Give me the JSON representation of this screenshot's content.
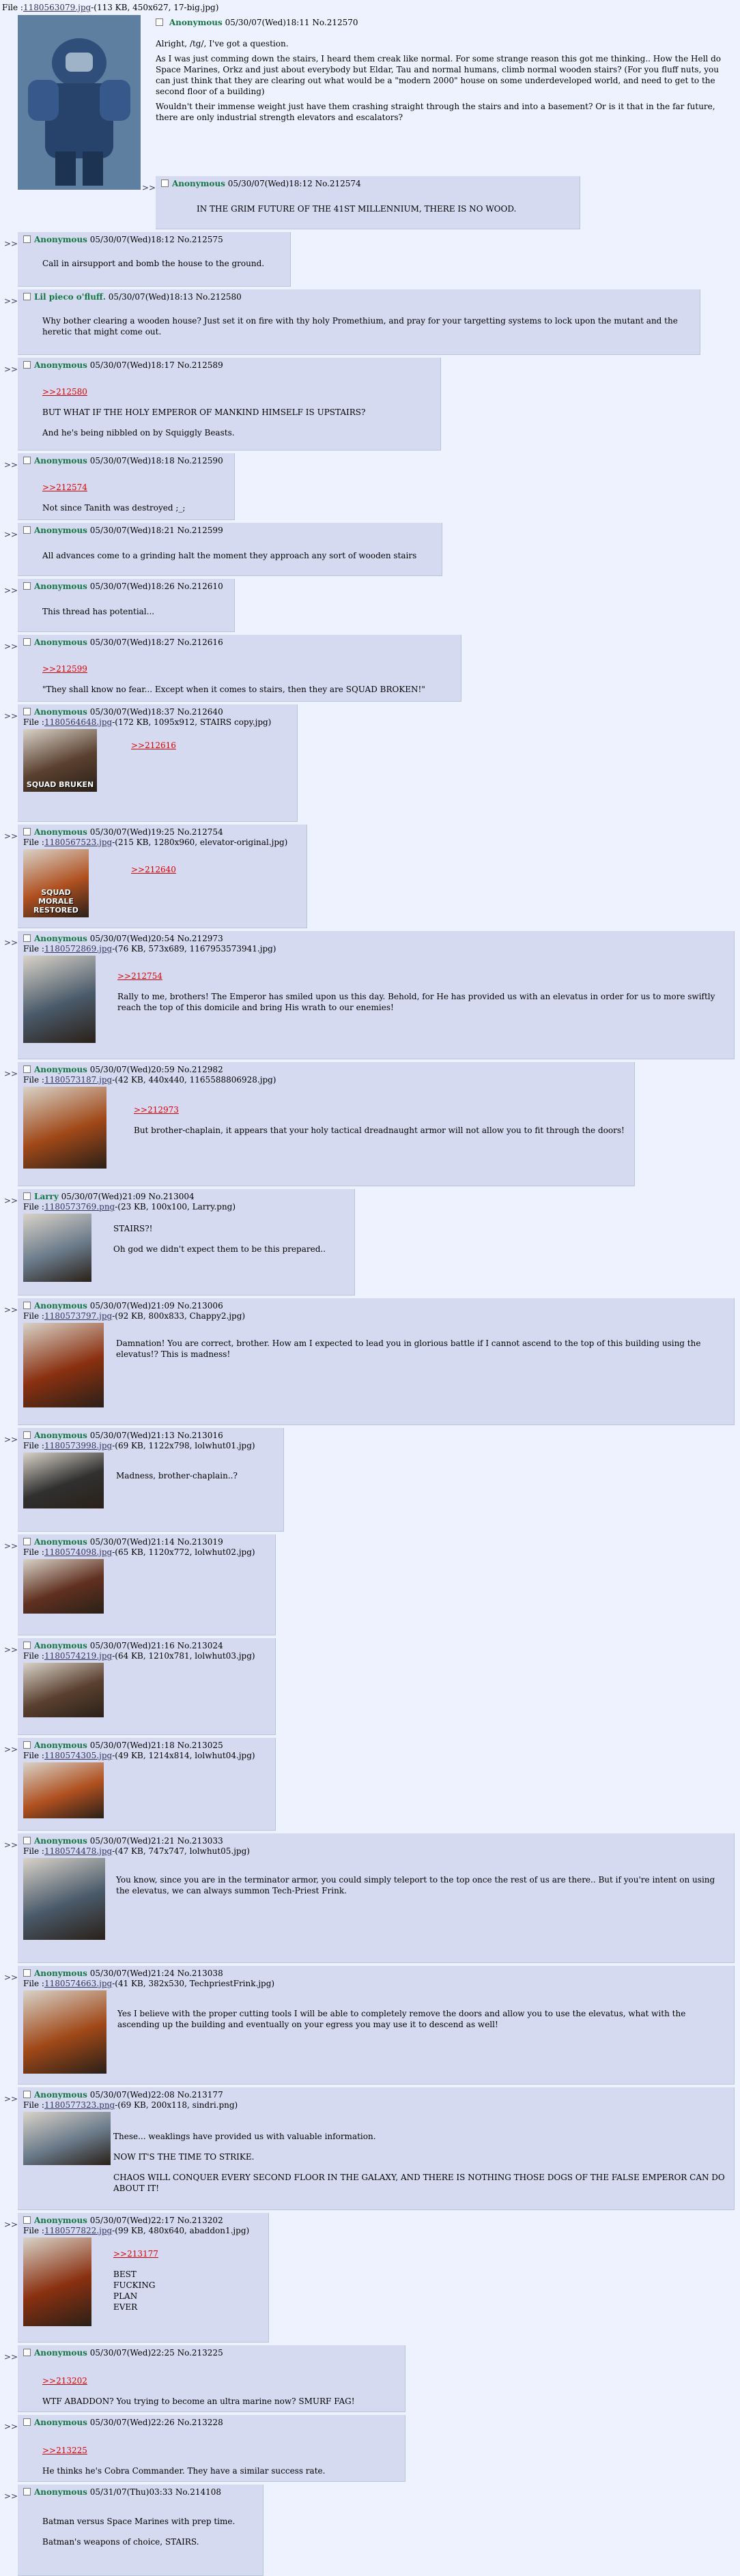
{
  "op": {
    "file_label": "File :",
    "file_name": "1180563079.jpg",
    "file_meta": "-(113 KB, 450x627, 17-big.jpg)",
    "name": "Anonymous",
    "date": "05/30/07(Wed)18:11",
    "no": "No.212570",
    "paragraphs": [
      "Alright, /tg/, I've got a question.",
      "As I was just comming down the stairs, I heard them creak like normal. For some strange reason this got me thinking.. How the Hell do Space Marines, Orkz and just about everybody but Eldar, Tau and normal humans, climb normal wooden stairs? (For you fluff nuts, you can just think that they are clearing out what would be a \"modern 2000\" house on some underdeveloped world, and need to get to the second floor of a building)",
      "Wouldn't their immense weight just have them crashing straight through the stairs and into a basement? Or is it that in the far future, there are only industrial strength elevators and escalators?"
    ]
  },
  "posts": [
    {
      "name": "Anonymous",
      "date": "05/30/07(Wed)18:12",
      "no": "No.212574",
      "lines": [
        "IN THE GRIM FUTURE OF THE 41ST MILLENNIUM, THERE IS NO WOOD."
      ]
    },
    {
      "name": "Anonymous",
      "date": "05/30/07(Wed)18:12",
      "no": "No.212575",
      "lines": [
        "Call in airsupport and bomb the house to the ground."
      ]
    },
    {
      "name": "Lil pieco o'fluff.",
      "date": "05/30/07(Wed)18:13",
      "no": "No.212580",
      "lines": [
        "Why bother clearing a wooden house? Just set it on fire with thy holy Promethium, and pray for your targetting systems to lock upon the mutant and the heretic that might come out."
      ]
    },
    {
      "name": "Anonymous",
      "date": "05/30/07(Wed)18:17",
      "no": "No.212589",
      "ref": ">>212580",
      "lines": [
        "BUT WHAT IF THE HOLY EMPEROR OF MANKIND HIMSELF IS UPSTAIRS?",
        "And he's being nibbled on by Squiggly Beasts."
      ]
    },
    {
      "name": "Anonymous",
      "date": "05/30/07(Wed)18:18",
      "no": "No.212590",
      "ref": ">>212574",
      "lines": [
        "Not since Tanith was destroyed ;_;"
      ]
    },
    {
      "name": "Anonymous",
      "date": "05/30/07(Wed)18:21",
      "no": "No.212599",
      "lines": [
        "All advances come to a grinding halt the moment they approach any sort of wooden stairs"
      ]
    },
    {
      "name": "Anonymous",
      "date": "05/30/07(Wed)18:26",
      "no": "No.212610",
      "lines": [
        "This thread has potential..."
      ]
    },
    {
      "name": "Anonymous",
      "date": "05/30/07(Wed)18:27",
      "no": "No.212616",
      "ref": ">>212599",
      "lines": [
        "\"They shall know no fear... Except when it comes to stairs, then they are SQUAD BROKEN!\""
      ]
    },
    {
      "name": "Anonymous",
      "date": "05/30/07(Wed)18:37",
      "no": "No.212640",
      "file": "1180564648.jpg",
      "meta": "-(172 KB, 1095x912, STAIRS copy.jpg)",
      "ref": ">>212616",
      "lines": [],
      "caption": "SQUAD BRUKEN"
    },
    {
      "name": "Anonymous",
      "date": "05/30/07(Wed)19:25",
      "no": "No.212754",
      "file": "1180567523.jpg",
      "meta": "-(215 KB, 1280x960, elevator-original.jpg)",
      "ref": ">>212640",
      "lines": [],
      "caption": "SQUAD MORALE RESTORED"
    },
    {
      "name": "Anonymous",
      "date": "05/30/07(Wed)20:54",
      "no": "No.212973",
      "file": "1180572869.jpg",
      "meta": "-(76 KB, 573x689, 1167953573941.jpg)",
      "ref": ">>212754",
      "lines": [
        "Rally to me, brothers! The Emperor has smiled upon us this day. Behold, for He has provided us with an elevatus in order for us to more swiftly reach the top of this domicile and bring His wrath to our enemies!"
      ]
    },
    {
      "name": "Anonymous",
      "date": "05/30/07(Wed)20:59",
      "no": "No.212982",
      "file": "1180573187.jpg",
      "meta": "-(42 KB, 440x440, 1165588806928.jpg)",
      "ref": ">>212973",
      "lines": [
        "But brother-chaplain, it appears that your holy tactical dreadnaught armor will not allow you to fit through the doors!"
      ]
    },
    {
      "name": "Larry",
      "date": "05/30/07(Wed)21:09",
      "no": "No.213004",
      "file": "1180573769.png",
      "meta": "-(23 KB, 100x100, Larry.png)",
      "lines": [
        "STAIRS?!",
        "Oh god we didn't expect them to be this prepared.."
      ]
    },
    {
      "name": "Anonymous",
      "date": "05/30/07(Wed)21:09",
      "no": "No.213006",
      "file": "1180573797.jpg",
      "meta": "-(92 KB, 800x833, Chappy2.jpg)",
      "lines": [
        "Damnation! You are correct, brother. How am I expected to lead you in glorious battle if I cannot ascend to the top of this building using the elevatus!? This is madness!"
      ]
    },
    {
      "name": "Anonymous",
      "date": "05/30/07(Wed)21:13",
      "no": "No.213016",
      "file": "1180573998.jpg",
      "meta": "-(69 KB, 1122x798, lolwhut01.jpg)",
      "lines": [
        "Madness, brother-chaplain..?"
      ]
    },
    {
      "name": "Anonymous",
      "date": "05/30/07(Wed)21:14",
      "no": "No.213019",
      "file": "1180574098.jpg",
      "meta": "-(65 KB, 1120x772, lolwhut02.jpg)",
      "lines": []
    },
    {
      "name": "Anonymous",
      "date": "05/30/07(Wed)21:16",
      "no": "No.213024",
      "file": "1180574219.jpg",
      "meta": "-(64 KB, 1210x781, lolwhut03.jpg)",
      "lines": []
    },
    {
      "name": "Anonymous",
      "date": "05/30/07(Wed)21:18",
      "no": "No.213025",
      "file": "1180574305.jpg",
      "meta": "-(49 KB, 1214x814, lolwhut04.jpg)",
      "lines": []
    },
    {
      "name": "Anonymous",
      "date": "05/30/07(Wed)21:21",
      "no": "No.213033",
      "file": "1180574478.jpg",
      "meta": "-(47 KB, 747x747, lolwhut05.jpg)",
      "lines": [
        "You know, since you are in the terminator armor, you could simply teleport to the top once the rest of us are there.. But if you're intent on using the elevatus, we can always summon Tech-Priest Frink."
      ]
    },
    {
      "name": "Anonymous",
      "date": "05/30/07(Wed)21:24",
      "no": "No.213038",
      "file": "1180574663.jpg",
      "meta": "-(41 KB, 382x530, TechpriestFrink.jpg)",
      "lines": [
        "Yes I believe with the proper cutting tools I will be able to completely remove the doors and allow you to use the elevatus, what with the ascending up the building and eventually on your egress you may use it to descend as well!"
      ]
    },
    {
      "name": "Anonymous",
      "date": "05/30/07(Wed)22:08",
      "no": "No.213177",
      "file": "1180577323.png",
      "meta": "-(69 KB, 200x118, sindri.png)",
      "lines": [
        "These... weaklings have provided us with valuable information.",
        "NOW IT'S THE TIME TO STRIKE.",
        "CHAOS WILL CONQUER EVERY SECOND FLOOR IN THE GALAXY, AND THERE IS NOTHING THOSE DOGS OF THE FALSE EMPEROR CAN DO ABOUT IT!"
      ]
    },
    {
      "name": "Anonymous",
      "date": "05/30/07(Wed)22:17",
      "no": "No.213202",
      "file": "1180577822.jpg",
      "meta": "-(99 KB, 480x640, abaddon1.jpg)",
      "ref": ">>213177",
      "lines": [
        "BEST",
        "FUCKING",
        "PLAN",
        "EVER"
      ]
    },
    {
      "name": "Anonymous",
      "date": "05/30/07(Wed)22:25",
      "no": "No.213225",
      "ref": ">>213202",
      "lines": [
        "WTF ABADDON? You trying to become an ultra marine now? SMURF FAG!"
      ]
    },
    {
      "name": "Anonymous",
      "date": "05/30/07(Wed)22:26",
      "no": "No.213228",
      "ref": ">>213225",
      "lines": [
        "He thinks he's Cobra Commander. They have a similar success rate."
      ]
    },
    {
      "name": "Anonymous",
      "date": "05/31/07(Thu)03:33",
      "no": "No.214108",
      "lines": [
        "Batman versus Space Marines with prep time.",
        "Batman's weapons of choice, STAIRS."
      ]
    }
  ],
  "reply_arrow": ">>",
  "file_label": "File :",
  "colors": {
    "background": "#eef2ff",
    "reply_bg": "#d6daf0",
    "name_green": "#117743",
    "link_red": "#dd0000"
  }
}
